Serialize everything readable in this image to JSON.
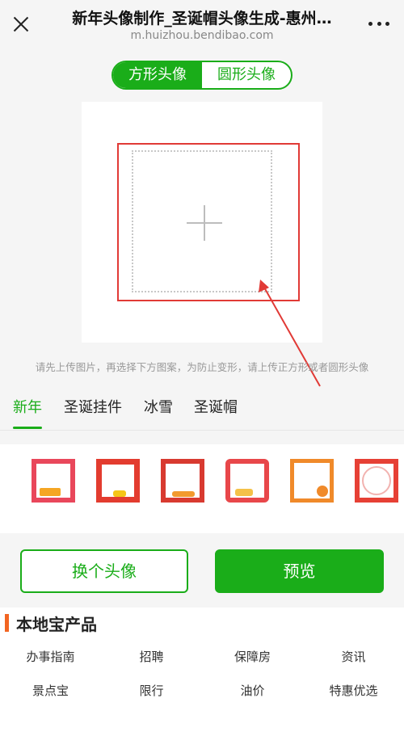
{
  "header": {
    "title": "新年头像制作_圣诞帽头像生成-惠州…",
    "url": "m.huizhou.bendibao.com"
  },
  "shape_toggle": {
    "square_label": "方形头像",
    "round_label": "圆形头像",
    "selected": "square"
  },
  "canvas": {
    "upload_icon": "plus-icon"
  },
  "hint": "请先上传图片，再选择下方图案，为防止变形，请上传正方形或者圆形头像",
  "tabs": [
    "新年",
    "圣诞挂件",
    "冰雪",
    "圣诞帽"
  ],
  "active_tab": "新年",
  "frames": [
    "frame-1",
    "frame-2",
    "frame-3",
    "frame-4",
    "frame-5",
    "frame-6"
  ],
  "buttons": {
    "change_label": "换个头像",
    "preview_label": "预览"
  },
  "products": {
    "title": "本地宝产品",
    "links": [
      "办事指南",
      "招聘",
      "保障房",
      "资讯",
      "景点宝",
      "限行",
      "油价",
      "特惠优选"
    ]
  },
  "colors": {
    "accent": "#1aad19",
    "frame_red": "#e13a36",
    "section_bar": "#f26522"
  }
}
